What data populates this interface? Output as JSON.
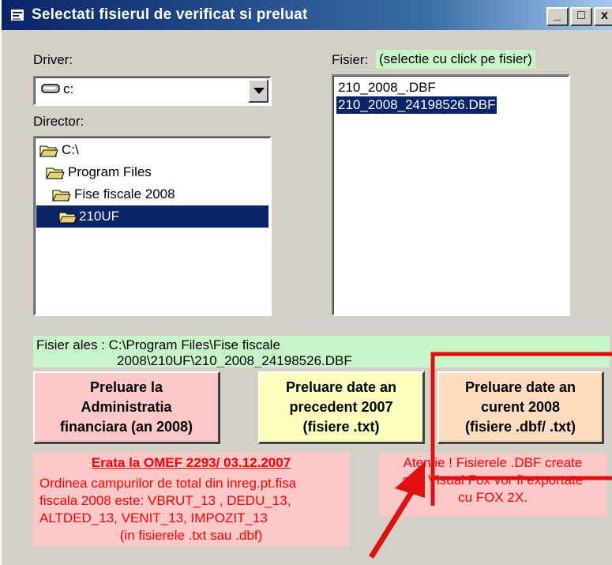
{
  "window": {
    "title": "Selectati fisierul de verificat si preluat",
    "minimize_glyph": "_",
    "maximize_glyph": "□",
    "close_glyph": "x"
  },
  "driver": {
    "label": "Driver:",
    "value": "c:"
  },
  "director": {
    "label": "Director:",
    "items": [
      {
        "label": "C:\\"
      },
      {
        "label": "Program Files"
      },
      {
        "label": "Fise fiscale 2008"
      },
      {
        "label": "210UF",
        "selected": true
      }
    ]
  },
  "fisier": {
    "label": "Fisier:",
    "hint": "(selectie cu click pe fisier)",
    "items": [
      {
        "label": "210_2008_.DBF"
      },
      {
        "label": "210_2008_24198526.DBF",
        "selected": true
      }
    ]
  },
  "selected_file": {
    "line1": "Fisier ales : C:\\Program Files\\Fise fiscale",
    "line2": "2008\\210UF\\210_2008_24198526.DBF"
  },
  "buttons": {
    "preluare_administratia": "Preluare la\nAdministratia\nfinanciara (an 2008)",
    "preluare_precedent": "Preluare date an\nprecedent 2007\n(fisiere .txt)",
    "preluare_curent": "Preluare date an\ncurent 2008\n(fisiere .dbf/ .txt)"
  },
  "erata": {
    "title": "Erata la OMEF 2293/ 03.12.2007",
    "line1": "Ordinea campurilor de total din inreg.pt.fisa",
    "line2": "fiscala 2008 este: VBRUT_13 , DEDU_13,",
    "line3": "ALTDED_13, VENIT_13, IMPOZIT_13",
    "line4": "(in fisierele .txt sau .dbf)"
  },
  "atentie": {
    "line1": "Atentie ! Fisierele .DBF create",
    "line2": "sub Visual Fox vor fi exportate",
    "line3": "cu FOX 2X."
  },
  "colors": {
    "title_bar_start": "#0a246a",
    "title_bar_end": "#a6caf0",
    "face": "#d4d0c8",
    "selection": "#0a246a",
    "green_bg": "#c8f5c8",
    "pink_bg": "#ffc8c8",
    "yellow_bg": "#ffffc0",
    "peach_bg": "#ffdcbe",
    "annotation_red": "#e01010",
    "warning_text": "#ff0000"
  }
}
